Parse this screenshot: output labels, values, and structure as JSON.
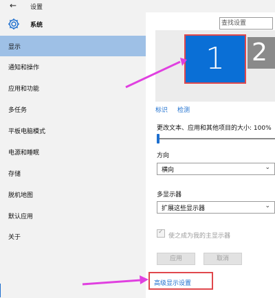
{
  "window": {
    "title": "设置",
    "back_icon": "back-arrow-icon"
  },
  "sidebar": {
    "header": "系统",
    "items": [
      {
        "label": "显示",
        "active": true
      },
      {
        "label": "通知和操作"
      },
      {
        "label": "应用和功能"
      },
      {
        "label": "多任务"
      },
      {
        "label": "平板电脑模式"
      },
      {
        "label": "电源和睡眠"
      },
      {
        "label": "存储"
      },
      {
        "label": "脱机地图"
      },
      {
        "label": "默认应用"
      },
      {
        "label": "关于"
      }
    ]
  },
  "search": {
    "placeholder": "查找设置"
  },
  "display_preview": {
    "monitor1": "1",
    "monitor2": "2",
    "selected_color": "#0a6fd6",
    "highlight_color": "#e0474c"
  },
  "links": {
    "identify": "标识",
    "detect": "检测",
    "advanced": "高级显示设置"
  },
  "scale": {
    "label": "更改文本、应用和其他项目的大小: 100%",
    "value_percent": 100
  },
  "orientation": {
    "label": "方向",
    "value": "横向"
  },
  "multi_display": {
    "label": "多显示器",
    "value": "扩展这些显示器"
  },
  "primary": {
    "label": "使之成为我的主显示器",
    "checked": true,
    "enabled": false
  },
  "buttons": {
    "apply": "应用",
    "cancel": "取消"
  },
  "annotations": {
    "arrow_color": "#e040e0"
  }
}
